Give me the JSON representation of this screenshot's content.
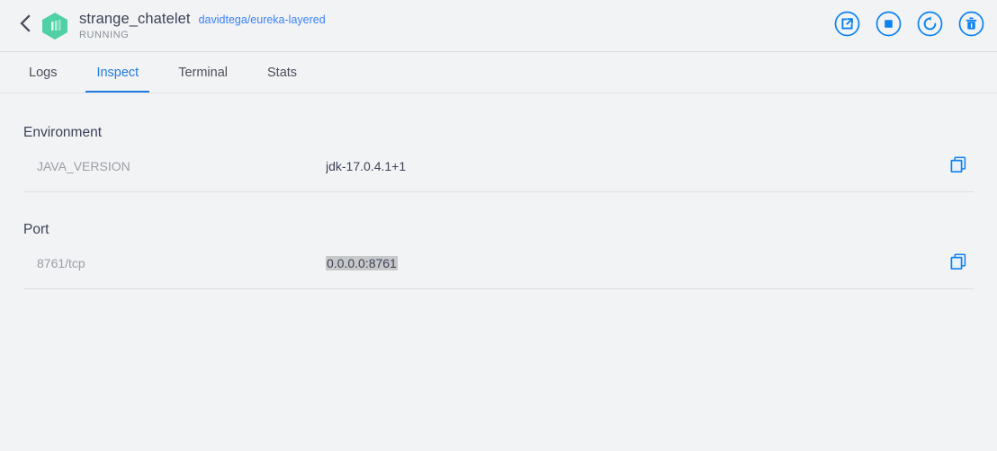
{
  "header": {
    "back_icon": "chevron-left-icon",
    "container_icon": "container-cube-icon",
    "container_name": "strange_chatelet",
    "image_link": "davidtega/eureka-layered",
    "status": "RUNNING",
    "actions": [
      {
        "name": "open-in-browser",
        "icon": "external-link-icon"
      },
      {
        "name": "stop-container",
        "icon": "stop-square-icon"
      },
      {
        "name": "restart-container",
        "icon": "restart-arrow-icon"
      },
      {
        "name": "delete-container",
        "icon": "trash-icon"
      }
    ]
  },
  "tabs": [
    {
      "label": "Logs",
      "active": false
    },
    {
      "label": "Inspect",
      "active": true
    },
    {
      "label": "Terminal",
      "active": false
    },
    {
      "label": "Stats",
      "active": false
    }
  ],
  "sections": [
    {
      "title": "Environment",
      "rows": [
        {
          "key": "JAVA_VERSION",
          "value": "jdk-17.0.4.1+1",
          "selected": false,
          "copy_icon": "copy-icon"
        }
      ]
    },
    {
      "title": "Port",
      "rows": [
        {
          "key": "8761/tcp",
          "value": "0.0.0.0:8761",
          "selected": true,
          "copy_icon": "copy-icon"
        }
      ]
    }
  ],
  "colors": {
    "accent_blue": "#0b82f0",
    "link_blue": "#3b82f6",
    "tab_active": "#1f7ae0",
    "container_teal": "#4fd1a5",
    "background": "#f2f3f5",
    "text_primary": "#3c4257",
    "text_muted": "#9a9ea6",
    "selection": "#c7c8ca"
  }
}
